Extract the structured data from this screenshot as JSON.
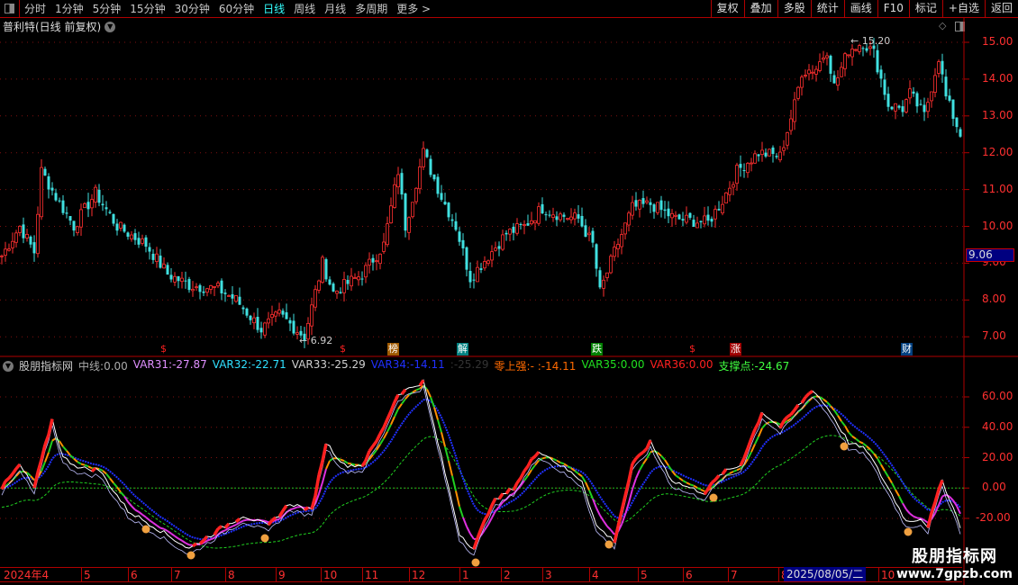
{
  "toolbar": {
    "periods": [
      "分时",
      "1分钟",
      "5分钟",
      "15分钟",
      "30分钟",
      "60分钟",
      "日线",
      "周线",
      "月线",
      "多周期",
      "更多 >"
    ],
    "active": "日线",
    "buttons": [
      "复权",
      "叠加",
      "多股",
      "统计",
      "画线",
      "F10",
      "标记",
      "+自选",
      "返回"
    ]
  },
  "chart_title": "普利特(日线 前复权)",
  "price_axis": {
    "labels": [
      "15.00",
      "14.00",
      "13.00",
      "12.00",
      "11.00",
      "10.00",
      "9.00",
      "8.00",
      "7.00"
    ],
    "last_price": "9.06"
  },
  "annotations": {
    "high": "15.20",
    "low": "6.92"
  },
  "signals": [
    {
      "text": "$",
      "color": "#ff2020",
      "bg": "transparent"
    },
    {
      "text": "$",
      "color": "#ff2020",
      "bg": "transparent"
    },
    {
      "text": "榜",
      "color": "#fff",
      "bg": "#a05a00"
    },
    {
      "text": "解",
      "color": "#fff",
      "bg": "#008080"
    },
    {
      "text": "跌",
      "color": "#fff",
      "bg": "#008000"
    },
    {
      "text": "$",
      "color": "#ff2020",
      "bg": "transparent"
    },
    {
      "text": "涨",
      "color": "#fff",
      "bg": "#a00000"
    },
    {
      "text": "财",
      "color": "#fff",
      "bg": "#004080"
    }
  ],
  "indicator": {
    "name": "股朋指标网",
    "items": [
      {
        "label": "中线:",
        "value": "0.00",
        "color": "#aaa"
      },
      {
        "label": "VAR31:",
        "value": "-27.87",
        "color": "#e090ff"
      },
      {
        "label": "VAR32:",
        "value": "-22.71",
        "color": "#30e0ff"
      },
      {
        "label": "VAR33:",
        "value": "-25.29",
        "color": "#d0d0d0"
      },
      {
        "label": "VAR34:",
        "value": "-14.11",
        "color": "#2030ff"
      },
      {
        "label": ":",
        "value": "-25.29",
        "color": "#333"
      },
      {
        "label": "零上强:",
        "value": "- :-14.11",
        "color": "#ff6a00"
      },
      {
        "label": "VAR35:",
        "value": "0.00",
        "color": "#20e020"
      },
      {
        "label": "VAR36:",
        "value": "0.00",
        "color": "#ff2020"
      },
      {
        "label": "支撑点:",
        "value": "-24.67",
        "color": "#40ff40"
      }
    ],
    "axis": [
      "60.00",
      "40.00",
      "20.00",
      "0.00",
      "-20.00"
    ]
  },
  "date_axis": {
    "labels": [
      "2024年4",
      "5",
      "6",
      "7",
      "8",
      "9",
      "10",
      "11",
      "12",
      "1",
      "2",
      "3",
      "4",
      "5",
      "6",
      "7",
      "8",
      "10"
    ],
    "current": "2025/08/05/二"
  },
  "watermark": {
    "title": "股朋指标网",
    "url": "www.7gpzb.com"
  },
  "chart_data": {
    "type": "candlestick",
    "price_keypoints_day_close": [
      [
        0,
        9.2
      ],
      [
        5,
        10.0
      ],
      [
        9,
        9.3
      ],
      [
        11,
        11.5
      ],
      [
        15,
        10.8
      ],
      [
        20,
        10.0
      ],
      [
        26,
        10.9
      ],
      [
        32,
        10.0
      ],
      [
        40,
        9.5
      ],
      [
        46,
        8.7
      ],
      [
        52,
        8.4
      ],
      [
        60,
        8.3
      ],
      [
        65,
        8.0
      ],
      [
        72,
        7.2
      ],
      [
        77,
        7.6
      ],
      [
        84,
        7.0
      ],
      [
        89,
        9.0
      ],
      [
        92,
        8.2
      ],
      [
        100,
        8.7
      ],
      [
        106,
        9.5
      ],
      [
        110,
        11.5
      ],
      [
        112,
        10.0
      ],
      [
        117,
        12.0
      ],
      [
        122,
        10.8
      ],
      [
        126,
        10.0
      ],
      [
        130,
        8.6
      ],
      [
        135,
        9.2
      ],
      [
        140,
        9.8
      ],
      [
        145,
        10.0
      ],
      [
        150,
        10.5
      ],
      [
        155,
        10.3
      ],
      [
        160,
        10.2
      ],
      [
        164,
        9.5
      ],
      [
        166,
        8.2
      ],
      [
        170,
        9.3
      ],
      [
        175,
        10.5
      ],
      [
        180,
        10.6
      ],
      [
        187,
        10.2
      ],
      [
        196,
        10.1
      ],
      [
        200,
        10.7
      ],
      [
        204,
        11.5
      ],
      [
        210,
        12.0
      ],
      [
        216,
        11.9
      ],
      [
        220,
        13.3
      ],
      [
        222,
        14.2
      ],
      [
        226,
        14.3
      ],
      [
        229,
        14.8
      ],
      [
        231,
        13.8
      ],
      [
        235,
        14.8
      ],
      [
        239,
        15.0
      ],
      [
        242,
        14.7
      ],
      [
        246,
        13.3
      ],
      [
        250,
        13.2
      ],
      [
        252,
        13.6
      ],
      [
        256,
        13.0
      ],
      [
        260,
        14.6
      ],
      [
        262,
        13.5
      ],
      [
        266,
        12.5
      ]
    ],
    "oscillator_keypoints": [
      [
        0,
        0
      ],
      [
        5,
        15
      ],
      [
        9,
        0
      ],
      [
        14,
        45
      ],
      [
        17,
        20
      ],
      [
        22,
        13
      ],
      [
        27,
        12
      ],
      [
        35,
        -15
      ],
      [
        42,
        -25
      ],
      [
        52,
        -40
      ],
      [
        60,
        -28
      ],
      [
        67,
        -18
      ],
      [
        74,
        -25
      ],
      [
        80,
        -10
      ],
      [
        86,
        -15
      ],
      [
        90,
        30
      ],
      [
        95,
        15
      ],
      [
        100,
        15
      ],
      [
        105,
        35
      ],
      [
        110,
        62
      ],
      [
        117,
        70
      ],
      [
        122,
        20
      ],
      [
        127,
        -30
      ],
      [
        131,
        -40
      ],
      [
        136,
        -10
      ],
      [
        142,
        0
      ],
      [
        149,
        25
      ],
      [
        155,
        15
      ],
      [
        161,
        5
      ],
      [
        165,
        -25
      ],
      [
        170,
        -35
      ],
      [
        175,
        15
      ],
      [
        180,
        30
      ],
      [
        186,
        5
      ],
      [
        191,
        0
      ],
      [
        195,
        -3
      ],
      [
        200,
        10
      ],
      [
        205,
        15
      ],
      [
        211,
        50
      ],
      [
        216,
        40
      ],
      [
        225,
        65
      ],
      [
        230,
        50
      ],
      [
        235,
        30
      ],
      [
        240,
        25
      ],
      [
        246,
        0
      ],
      [
        251,
        -22
      ],
      [
        255,
        -20
      ],
      [
        257,
        -25
      ],
      [
        261,
        5
      ],
      [
        266,
        -25
      ]
    ],
    "price_range": [
      6.7,
      15.4
    ],
    "indicator_range": [
      -30,
      75
    ]
  }
}
